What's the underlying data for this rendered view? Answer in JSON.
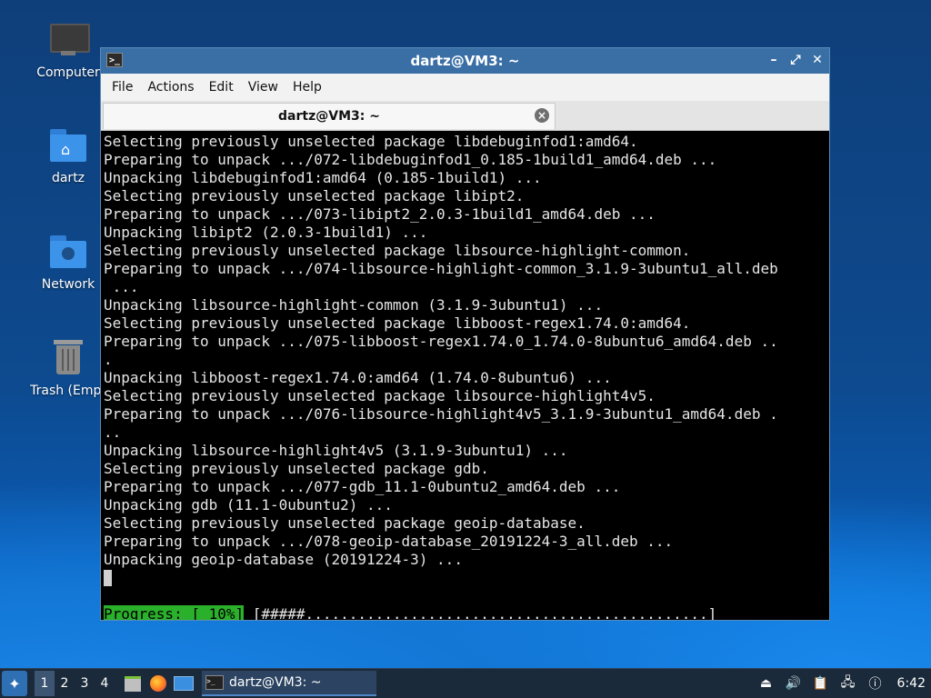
{
  "desktop": {
    "icons": [
      {
        "label": "Computer",
        "icon": "computer-icon"
      },
      {
        "label": "dartz",
        "icon": "home-folder-icon"
      },
      {
        "label": "Network",
        "icon": "network-folder-icon"
      },
      {
        "label": "Trash (Empt",
        "icon": "trash-icon"
      }
    ]
  },
  "window": {
    "title": "dartz@VM3: ~",
    "menu": [
      "File",
      "Actions",
      "Edit",
      "View",
      "Help"
    ],
    "tab_label": "dartz@VM3: ~",
    "controls": {
      "minimize": "–",
      "maximize": "⤢",
      "close": "✕"
    }
  },
  "terminal": {
    "lines": [
      "Selecting previously unselected package libdebuginfod1:amd64.",
      "Preparing to unpack .../072-libdebuginfod1_0.185-1build1_amd64.deb ...",
      "Unpacking libdebuginfod1:amd64 (0.185-1build1) ...",
      "Selecting previously unselected package libipt2.",
      "Preparing to unpack .../073-libipt2_2.0.3-1build1_amd64.deb ...",
      "Unpacking libipt2 (2.0.3-1build1) ...",
      "Selecting previously unselected package libsource-highlight-common.",
      "Preparing to unpack .../074-libsource-highlight-common_3.1.9-3ubuntu1_all.deb",
      " ...",
      "Unpacking libsource-highlight-common (3.1.9-3ubuntu1) ...",
      "Selecting previously unselected package libboost-regex1.74.0:amd64.",
      "Preparing to unpack .../075-libboost-regex1.74.0_1.74.0-8ubuntu6_amd64.deb ..",
      ".",
      "Unpacking libboost-regex1.74.0:amd64 (1.74.0-8ubuntu6) ...",
      "Selecting previously unselected package libsource-highlight4v5.",
      "Preparing to unpack .../076-libsource-highlight4v5_3.1.9-3ubuntu1_amd64.deb .",
      "..",
      "Unpacking libsource-highlight4v5 (3.1.9-3ubuntu1) ...",
      "Selecting previously unselected package gdb.",
      "Preparing to unpack .../077-gdb_11.1-0ubuntu2_amd64.deb ...",
      "Unpacking gdb (11.1-0ubuntu2) ...",
      "Selecting previously unselected package geoip-database.",
      "Preparing to unpack .../078-geoip-database_20191224-3_all.deb ...",
      "Unpacking geoip-database (20191224-3) ..."
    ],
    "progress_label": "Progress: [ 10%]",
    "progress_bar": " [#####..............................................]",
    "progress_percent": 10
  },
  "taskbar": {
    "workspaces": [
      "1",
      "2",
      "3",
      "4"
    ],
    "active_workspace": "1",
    "task_label": "dartz@VM3: ~",
    "clock": "6:42"
  }
}
